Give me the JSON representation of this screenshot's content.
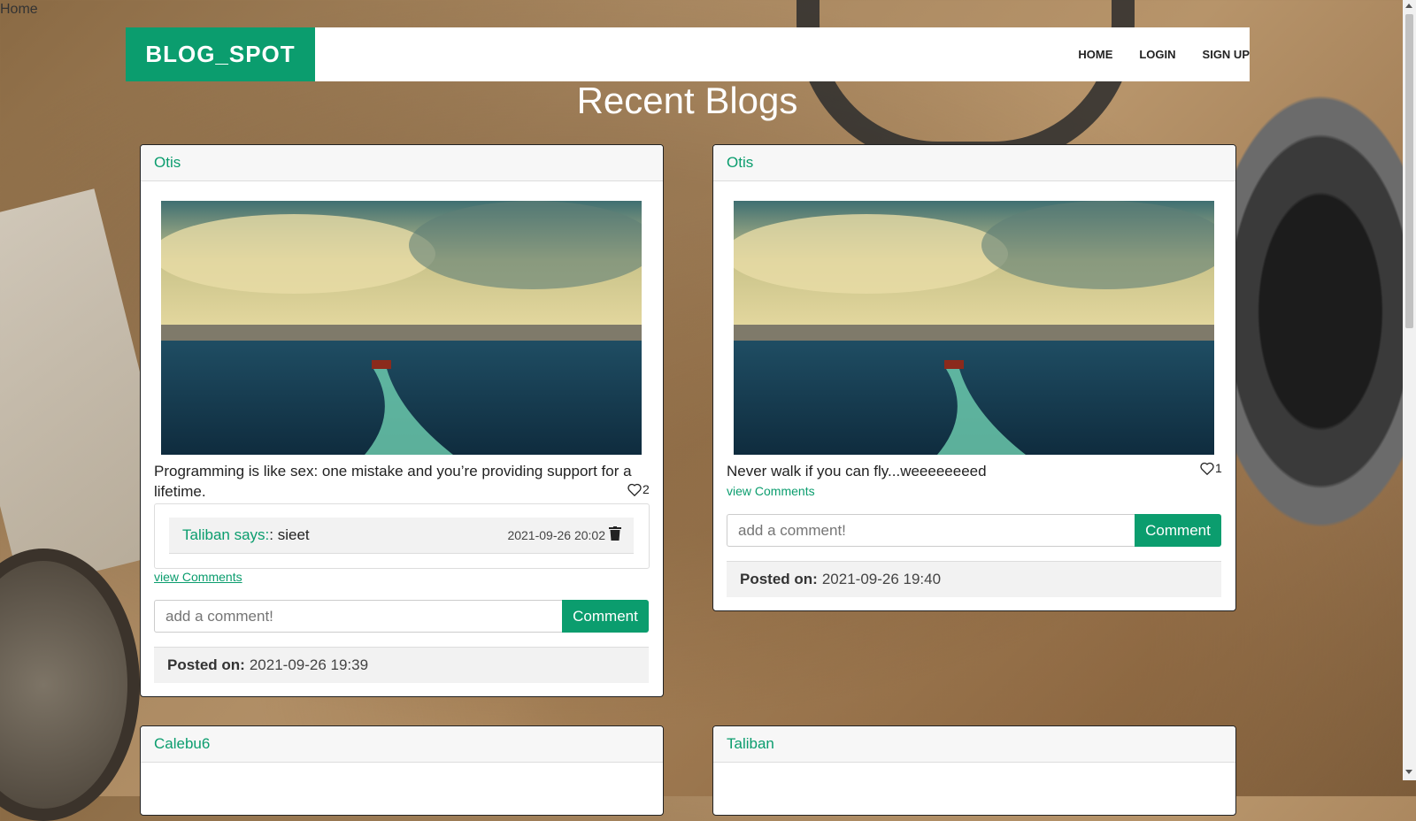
{
  "home_link": "Home",
  "nav": {
    "brand": "BLOG_SPOT",
    "links": [
      "HOME",
      "LOGIN",
      "SIGN UP"
    ]
  },
  "page_title": "Recent Blogs",
  "posts": [
    {
      "author": "Otis",
      "text": "Programming is like sex: one mistake and you’re providing support for a lifetime.",
      "likes": "2",
      "comments": [
        {
          "author": "Taliban says:",
          "text": ": sieet",
          "date": "2021-09-26 20:02"
        }
      ],
      "view_comments": "view Comments",
      "comment_placeholder": "add a comment!",
      "comment_button": "Comment",
      "posted_label": "Posted on:",
      "posted_date": "2021-09-26 19:39"
    },
    {
      "author": "Otis",
      "text": "Never walk if you can fly...weeeeeeeed",
      "likes": "1",
      "view_comments": "view Comments",
      "comment_placeholder": "add a comment!",
      "comment_button": "Comment",
      "posted_label": "Posted on:",
      "posted_date": "2021-09-26 19:40"
    },
    {
      "author": "Calebu6"
    },
    {
      "author": "Taliban"
    }
  ],
  "colors": {
    "accent": "#0b9d6e"
  },
  "icons": {
    "like": "heart-outline-icon",
    "delete": "trash-icon"
  }
}
